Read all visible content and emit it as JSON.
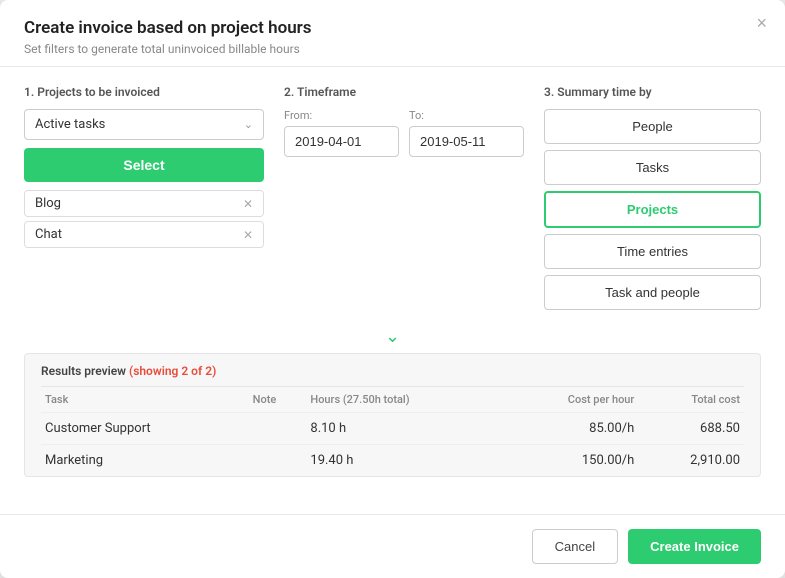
{
  "dialog": {
    "title": "Create invoice based on project hours",
    "subtitle": "Set filters to generate total uninvoiced billable hours"
  },
  "close_label": "×",
  "sections": {
    "projects": {
      "label": "1. Projects to be invoiced",
      "dropdown_value": "Active tasks",
      "select_btn": "Select",
      "selected_items": [
        {
          "name": "Blog"
        },
        {
          "name": "Chat"
        }
      ]
    },
    "timeframe": {
      "label": "2. Timeframe",
      "from_label": "From:",
      "from_value": "2019-04-01",
      "to_label": "To:",
      "to_value": "2019-05-11"
    },
    "summary": {
      "label": "3. Summary time by",
      "buttons": [
        {
          "label": "People",
          "active": false
        },
        {
          "label": "Tasks",
          "active": false
        },
        {
          "label": "Projects",
          "active": true
        },
        {
          "label": "Time entries",
          "active": false
        },
        {
          "label": "Task and people",
          "active": false
        }
      ]
    }
  },
  "results": {
    "header": "Results preview",
    "count_text": "(showing 2 of 2)",
    "columns": [
      "Task",
      "Note",
      "Hours (27.50h total)",
      "Cost per hour",
      "Total cost"
    ],
    "rows": [
      {
        "task": "Customer Support",
        "note": "",
        "hours": "8.10 h",
        "cost_per_hour": "85.00/h",
        "total_cost": "688.50"
      },
      {
        "task": "Marketing",
        "note": "",
        "hours": "19.40 h",
        "cost_per_hour": "150.00/h",
        "total_cost": "2,910.00"
      }
    ]
  },
  "footer": {
    "cancel_label": "Cancel",
    "create_label": "Create Invoice"
  }
}
